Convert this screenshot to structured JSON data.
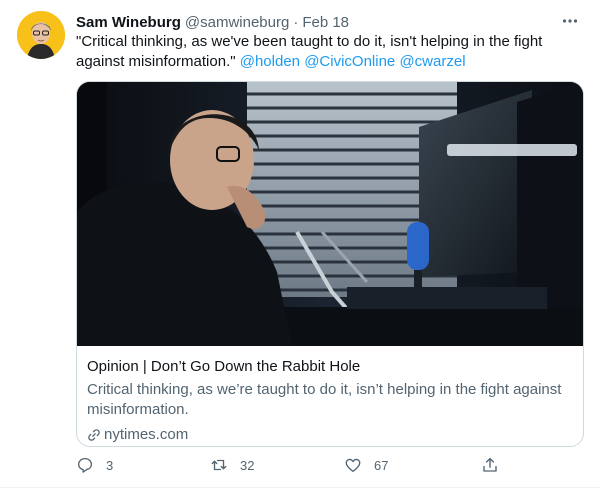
{
  "tweet": {
    "author_name": "Sam Wineburg",
    "author_handle": "@samwineburg",
    "separator": "·",
    "date": "Feb 18",
    "text_before": "\"Critical  thinking, as we've been taught to do it, isn't helping in the fight against misinformation.\"",
    "mentions": [
      "@holden",
      "@CivicOnline",
      "@cwarzel"
    ]
  },
  "card": {
    "title": "Opinion | Don’t Go Down the Rabbit Hole",
    "description": "Critical thinking, as we’re taught to do it, isn’t helping in the fight against misinformation.",
    "domain": "nytimes.com"
  },
  "actions": {
    "replies": "3",
    "retweets": "32",
    "likes": "67"
  },
  "colors": {
    "accent": "#1d9bf0",
    "secondary_text": "#536471",
    "border": "#cfd9de",
    "avatar_bg": "#f7c11a"
  },
  "icons": {
    "more": "more-icon",
    "reply": "reply-icon",
    "retweet": "retweet-icon",
    "like": "heart-icon",
    "share": "share-icon",
    "link": "link-icon"
  }
}
